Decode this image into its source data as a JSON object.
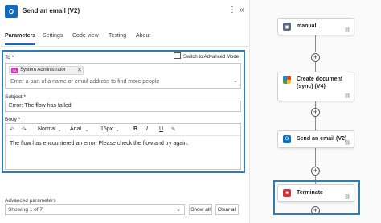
{
  "header": {
    "title": "Send an email (V2)",
    "app_icon_text": "O",
    "more_glyph": "⋮",
    "collapse_glyph": "«"
  },
  "tabs": [
    {
      "label": "Parameters",
      "active": true
    },
    {
      "label": "Settings"
    },
    {
      "label": "Code view"
    },
    {
      "label": "Testing"
    },
    {
      "label": "About"
    }
  ],
  "params": {
    "switch_label": "Switch to Advanced Mode",
    "to": {
      "label": "To *",
      "chip": {
        "initials": "SA",
        "name": "System Administrator",
        "remove": "✕"
      },
      "placeholder": "Enter a part of a name or email address to find more people",
      "chevron": "⌄"
    },
    "subject": {
      "label": "Subject *",
      "value": "Error: The flow has failed"
    },
    "body": {
      "label": "Body *",
      "toolbar": {
        "undo": "↶",
        "redo": "↷",
        "style": "Normal",
        "font": "Arial",
        "size": "15px",
        "bold": "B",
        "italic": "I",
        "underline": "U",
        "pen": "✎",
        "chevron": "⌄"
      },
      "text": "The flow has encountered an error. Please check the flow and try again."
    }
  },
  "advanced": {
    "label": "Advanced parameters",
    "selected": "Showing 1 of 7",
    "chevron": "⌄",
    "show_all": "Show all",
    "clear_all": "Clear all"
  },
  "flow": {
    "nodes": [
      {
        "label": "manual",
        "icon": "manual-trigger-icon"
      },
      {
        "label": "Create document (sync) (V4)",
        "icon": "create-document-icon"
      },
      {
        "label": "Send an email (V2)",
        "icon": "outlook-icon"
      },
      {
        "label": "Terminate",
        "icon": "terminate-icon"
      }
    ],
    "plus_glyph": "+",
    "link_glyph": "⛓"
  },
  "colors": {
    "accent": "#0f6cbd",
    "selection": "#2e7db5",
    "terminate": "#d13438",
    "manual": "#5c6a7a"
  }
}
